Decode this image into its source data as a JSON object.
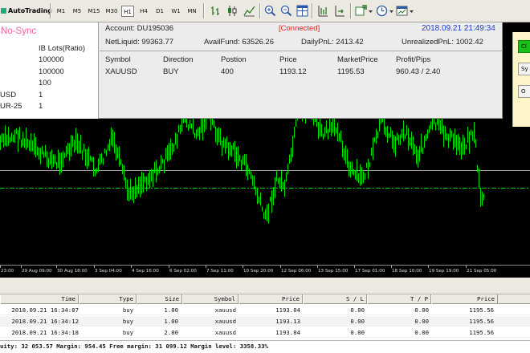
{
  "toolbar": {
    "autotrading_label": "AutoTrading",
    "timeframes": [
      "M1",
      "M5",
      "M15",
      "M30",
      "H1",
      "H4",
      "D1",
      "W1",
      "MN"
    ],
    "active_timeframe": "H1"
  },
  "panel": {
    "sync_status": "No-Sync",
    "ib_lots_header": "IB Lots(Ratio)",
    "ib_rows": [
      {
        "label": "",
        "value": "100000"
      },
      {
        "label": "",
        "value": "100000"
      },
      {
        "label": "",
        "value": "100"
      },
      {
        "label": "USD",
        "value": "1"
      },
      {
        "label": "UR-25",
        "value": "1"
      }
    ],
    "account_label": "Account: DU195036",
    "connection_status": "[Connected]",
    "datetime": "2018.09.21 21:49:34",
    "net_liquid": "NetLiquid: 99363.77",
    "avail_fund": "AvailFund: 63526.26",
    "daily_pnl": "DailyPnL: 2413.42",
    "unrealized_pnl": "UnrealizedPnL: 1002.42",
    "position_headers": [
      "Symbol",
      "Direction",
      "Postion",
      "Price",
      "MarketPrice",
      "Profit/Pips"
    ],
    "positions": [
      {
        "symbol": "XAUUSD",
        "direction": "BUY",
        "position": "400",
        "price": "1193.12",
        "market_price": "1195.53",
        "profit_pips": "960.43 / 2.40"
      }
    ]
  },
  "side_buttons": [
    "Cl",
    "Sy",
    "O"
  ],
  "time_axis": [
    "23:00",
    "29 Aug 09:00",
    "30 Aug 18:00",
    "3 Sep 04:00",
    "4 Sep 16:00",
    "6 Sep 02:00",
    "7 Sep 11:00",
    "10 Sep 20:00",
    "12 Sep 06:00",
    "13 Sep 15:00",
    "17 Sep 01:00",
    "18 Sep 10:00",
    "19 Sep 19:00",
    "21 Sep 05:00"
  ],
  "terminal": {
    "headers": [
      "Time",
      "Type",
      "Size",
      "Symbol",
      "Price",
      "S / L",
      "T / P",
      "Price"
    ],
    "rows": [
      {
        "time": "2018.09.21 16:34:07",
        "type": "buy",
        "size": "1.00",
        "symbol": "xauusd",
        "price": "1193.04",
        "sl": "0.00",
        "tp": "0.00",
        "cur_price": "1195.56"
      },
      {
        "time": "2018.09.21 16:34:12",
        "type": "buy",
        "size": "1.00",
        "symbol": "xauusd",
        "price": "1193.13",
        "sl": "0.00",
        "tp": "0.00",
        "cur_price": "1195.56"
      },
      {
        "time": "2018.09.21 16:34:18",
        "type": "buy",
        "size": "2.00",
        "symbol": "xauusd",
        "price": "1193.04",
        "sl": "0.00",
        "tp": "0.00",
        "cur_price": "1195.56"
      }
    ],
    "status_line": "uity: 32 053.57  Margin: 954.45  Free margin: 31 099.12  Margin level: 3358.33%"
  },
  "colors": {
    "candle": "#00e000",
    "level_line": "#00d000",
    "sync_status": "#f0609a",
    "connected": "#e0211d",
    "datetime": "#1e3cc8"
  }
}
